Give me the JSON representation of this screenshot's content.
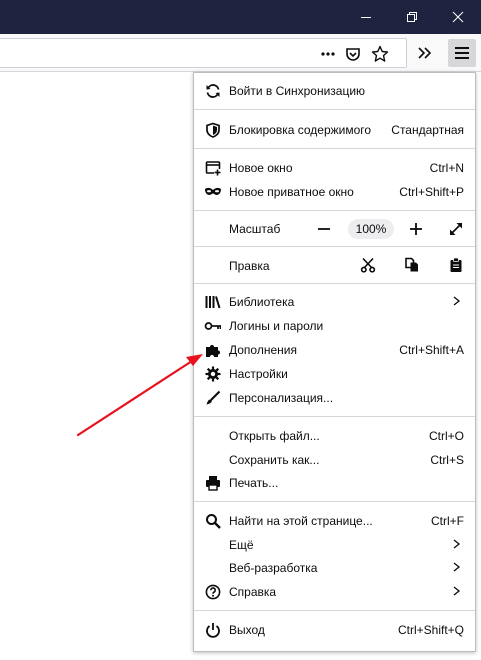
{
  "colors": {
    "titlebar": "#202340",
    "toolbar": "#f9f9fa",
    "arrow": "#e8111d",
    "icon": "#0c0c0d"
  },
  "window_controls": [
    {
      "name": "minimize",
      "icon": "minimize-icon"
    },
    {
      "name": "restore",
      "icon": "restore-icon"
    },
    {
      "name": "close",
      "icon": "close-icon"
    }
  ],
  "toolbar": {
    "url_value": "",
    "icons": [
      "page-actions-icon",
      "pocket-icon",
      "bookmark-star-icon",
      "overflow-icon",
      "hamburger-menu-icon"
    ]
  },
  "menu": {
    "sync": {
      "label": "Войти в Синхронизацию",
      "icon": "sync-icon"
    },
    "content_blocking": {
      "label": "Блокировка содержимого",
      "value": "Стандартная",
      "icon": "shield-icon"
    },
    "new_window": {
      "label": "Новое окно",
      "shortcut": "Ctrl+N",
      "icon": "new-window-icon"
    },
    "private_window": {
      "label": "Новое приватное окно",
      "shortcut": "Ctrl+Shift+P",
      "icon": "private-mask-icon"
    },
    "zoom": {
      "label": "Масштаб",
      "value": "100%"
    },
    "edit": {
      "label": "Правка"
    },
    "library": {
      "label": "Библиотека",
      "icon": "library-icon"
    },
    "logins": {
      "label": "Логины и пароли",
      "icon": "key-icon"
    },
    "addons": {
      "label": "Дополнения",
      "shortcut": "Ctrl+Shift+A",
      "icon": "puzzle-icon"
    },
    "settings": {
      "label": "Настройки",
      "icon": "gear-icon"
    },
    "customize": {
      "label": "Персонализация...",
      "icon": "brush-icon"
    },
    "open_file": {
      "label": "Открыть файл...",
      "shortcut": "Ctrl+O"
    },
    "save_as": {
      "label": "Сохранить как...",
      "shortcut": "Ctrl+S"
    },
    "print": {
      "label": "Печать...",
      "icon": "printer-icon"
    },
    "find": {
      "label": "Найти на этой странице...",
      "shortcut": "Ctrl+F",
      "icon": "search-icon"
    },
    "more": {
      "label": "Ещё"
    },
    "webdev": {
      "label": "Веб-разработка"
    },
    "help": {
      "label": "Справка",
      "icon": "help-icon"
    },
    "quit": {
      "label": "Выход",
      "shortcut": "Ctrl+Shift+Q",
      "icon": "power-icon"
    }
  }
}
